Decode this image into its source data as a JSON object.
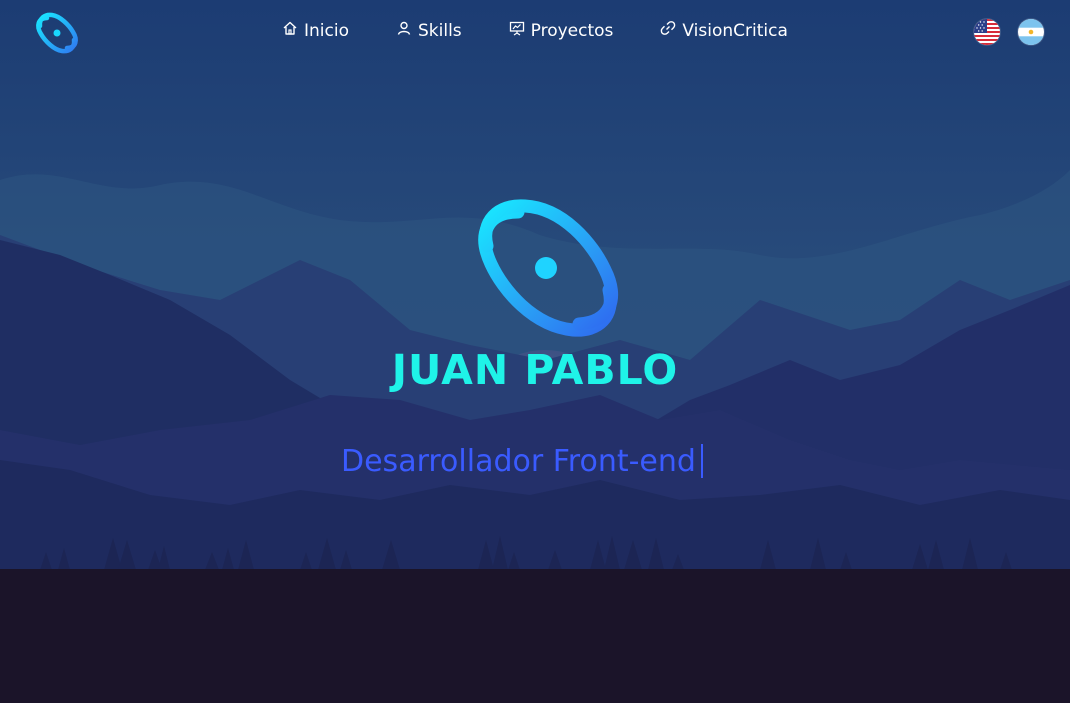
{
  "nav": {
    "items": [
      {
        "label": "Inicio",
        "icon": "home-icon"
      },
      {
        "label": "Skills",
        "icon": "user-icon"
      },
      {
        "label": "Proyectos",
        "icon": "presentation-icon"
      },
      {
        "label": "VisionCritica",
        "icon": "link-icon"
      }
    ],
    "languages": [
      "us-flag-icon",
      "argentina-flag-icon"
    ]
  },
  "hero": {
    "name": "JUAN PABLO",
    "role": "Desarrollador Front-end"
  },
  "colors": {
    "accent_cyan": "#1ff3e8",
    "accent_blue": "#3a5bff",
    "sky_top": "#1e3a6e",
    "ground": "#1b1429"
  }
}
